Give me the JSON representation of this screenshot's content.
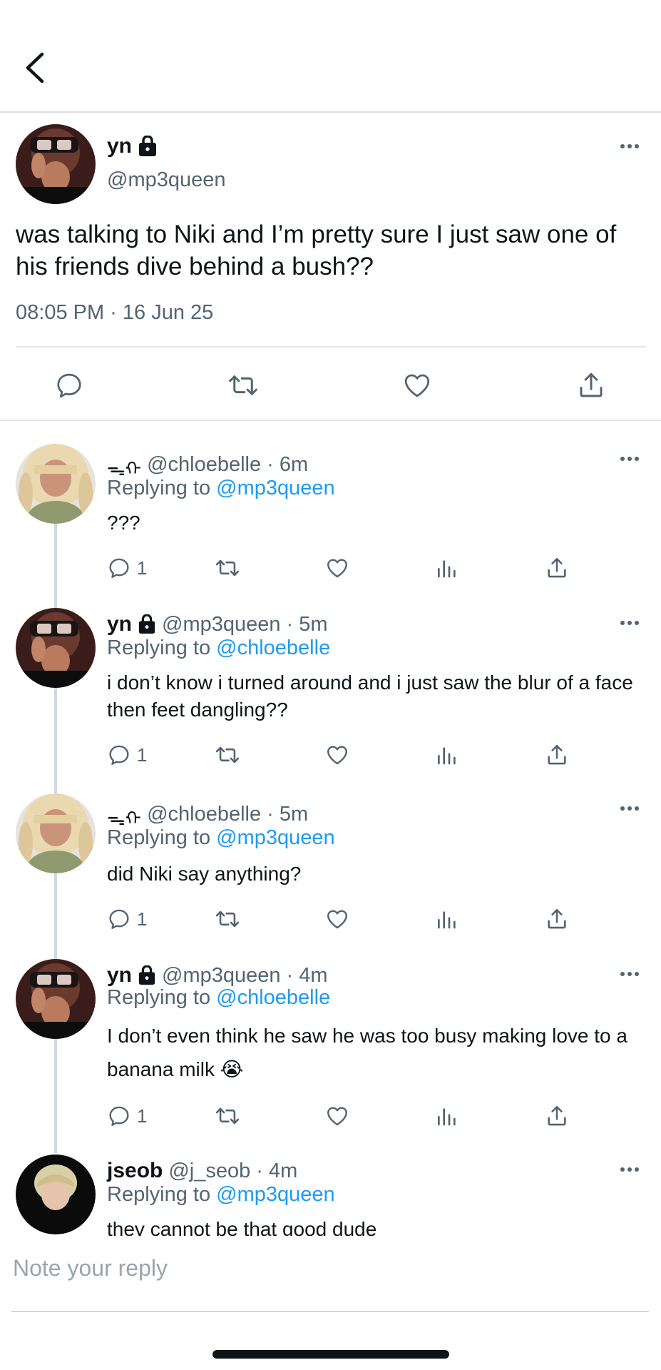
{
  "header": {
    "back_icon": "chevron-left-icon"
  },
  "main_tweet": {
    "name": "yn",
    "handle": "@mp3queen",
    "text": "was talking to Niki and I’m pretty sure I just saw one of his friends dive behind a bush??",
    "timestamp": "08:05 PM · 16 Jun 25",
    "actions": [
      "reply-icon",
      "retweet-icon",
      "like-icon",
      "share-icon"
    ]
  },
  "replies": [
    {
      "name": "",
      "badge": "ᯓᡣ",
      "handle": "@chloebelle",
      "time": "· 6m",
      "replying_prefix": "Replying to ",
      "replying_to": "@mp3queen",
      "text": "???",
      "reply_count": "1"
    },
    {
      "name": "yn",
      "handle": "@mp3queen",
      "time": "· 5m",
      "replying_prefix": "Replying to ",
      "replying_to": "@chloebelle",
      "text": "i don’t know i turned around and i just saw the blur of a face then feet dangling??",
      "reply_count": "1"
    },
    {
      "name": "",
      "badge": "ᯓᡣ",
      "handle": "@chloebelle",
      "time": "· 5m",
      "replying_prefix": "Replying to ",
      "replying_to": "@mp3queen",
      "text": "did Niki say anything?",
      "reply_count": "1"
    },
    {
      "name": "yn",
      "handle": "@mp3queen",
      "time": "· 4m",
      "replying_prefix": "Replying to ",
      "replying_to": "@chloebelle",
      "text": "I don’t even think he saw he was too busy  making love to a banana milk 😭",
      "reply_count": "1"
    },
    {
      "name": "jseob",
      "handle": "@j_seob",
      "time": "· 4m",
      "replying_prefix": "Replying to ",
      "replying_to": "@mp3queen",
      "text": "they cannot be that good dude"
    }
  ],
  "compose": {
    "placeholder": "Note your reply"
  },
  "colors": {
    "link": "#1d9bf0",
    "secondary": "#536471",
    "primary": "#0f1419"
  }
}
